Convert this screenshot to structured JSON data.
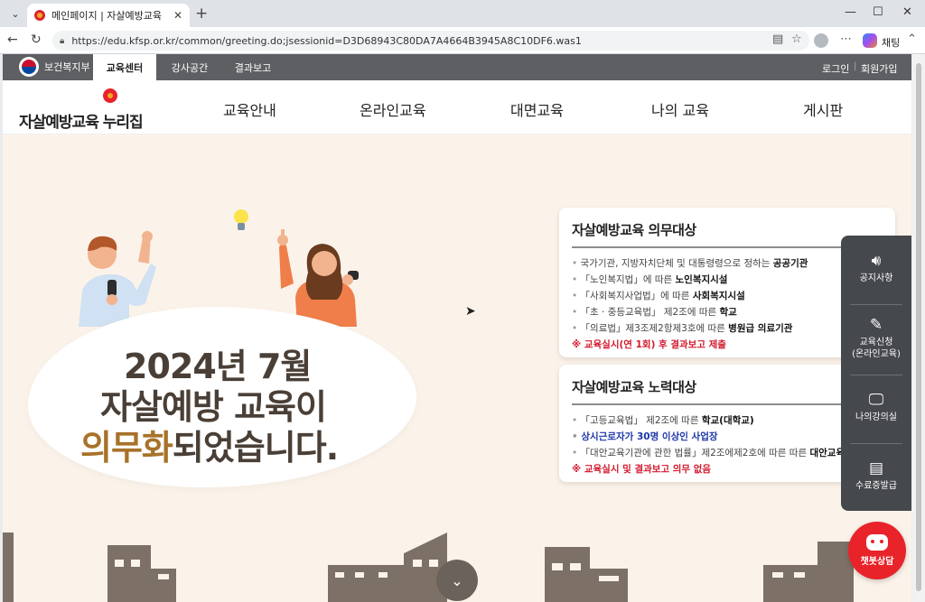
{
  "browser": {
    "tab_title": "메인페이지 | 자살예방교육",
    "url": "https://edu.kfsp.or.kr/common/greeting.do;jsessionid=D3D68943C80DA7A4664B3945A8C10DF6.was1",
    "copilot_label": "채팅"
  },
  "topbar": {
    "ministry": "보건복지부",
    "tabs": [
      "교육센터",
      "강사공간",
      "결과보고"
    ],
    "login": "로그인",
    "signup": "회원가입"
  },
  "header": {
    "logo": "자살예방교육 누리집",
    "nav": [
      "교육안내",
      "온라인교육",
      "대면교육",
      "나의 교육",
      "게시판"
    ]
  },
  "hero": {
    "line1": "2024년 7월",
    "line2": "자살예방 교육이",
    "line3_accent": "의무화",
    "line3_rest": "되었습니다."
  },
  "card_mandatory": {
    "title": "자살예방교육 의무대상",
    "items": [
      {
        "text": "국가기관, 지방자치단체 및 대통령령으로 정하는 ",
        "bold": "공공기관"
      },
      {
        "text": "「노인복지법」에 따른 ",
        "bold": "노인복지시설"
      },
      {
        "text": "「사회복지사업법」에 따른 ",
        "bold": "사회복지시설"
      },
      {
        "text": "「초 · 중등교육법」 제2조에 따른 ",
        "bold": "학교"
      },
      {
        "text": "「의료법」제3조제2항제3호에 따른 ",
        "bold": "병원급 의료기관"
      }
    ],
    "note": "※ 교육실시(연 1회) 후 결과보고 제출"
  },
  "card_effort": {
    "title": "자살예방교육 노력대상",
    "items": [
      {
        "text": "「고등교육법」 제2조에 따른 ",
        "bold": "학교(대학교)"
      },
      {
        "text": "상시근로자가 30명 이상인 사업장",
        "bold": ""
      },
      {
        "text": "「대안교육기관에 관한 법률」제2조에제2호에 따른 따른 ",
        "bold": "대안교육"
      }
    ],
    "note": "※ 교육실시 및 결과보고 의무 없음"
  },
  "quickmenu": {
    "items": [
      {
        "label": "공지사항",
        "icon": "speaker-icon"
      },
      {
        "label": "교육신청\n(온라인교육)",
        "icon": "edit-icon"
      },
      {
        "label": "나의강의실",
        "icon": "monitor-icon"
      },
      {
        "label": "수료증발급",
        "icon": "certificate-icon"
      }
    ]
  },
  "chatbot": {
    "label": "챗봇상담"
  }
}
